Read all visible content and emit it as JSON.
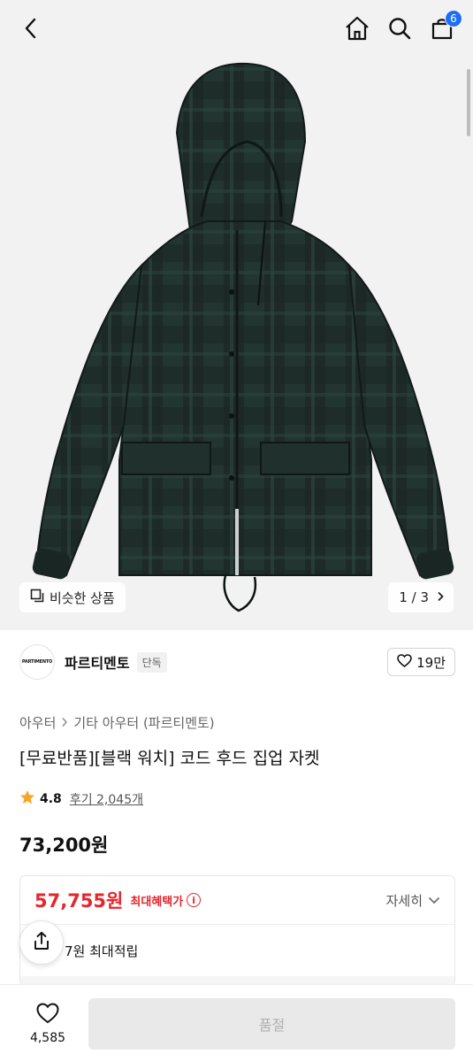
{
  "header": {
    "back_icon": "chevron-left-icon",
    "home_icon": "home-icon",
    "search_icon": "search-icon",
    "cart_icon": "shopping-bag-icon",
    "cart_count": "6"
  },
  "gallery": {
    "similar_label": "비슷한 상품",
    "pager_text": "1 / 3",
    "current_page": 1,
    "total_pages": 3
  },
  "brand": {
    "logo_text": "PARTIMENTO",
    "name": "파르티멘토",
    "tag": "단독",
    "likes": "19만"
  },
  "product": {
    "breadcrumb": [
      "아우터",
      "기타 아우터 (파르티멘토)"
    ],
    "title": "[무료반품][블랙 워치] 코드 후드 집업 자켓",
    "rating": "4.8",
    "reviews": "후기 2,045개",
    "price": "73,200원"
  },
  "benefit": {
    "max_price": "57,755원",
    "max_label": "최대혜택가",
    "detail_label": "자세히",
    "points_text": "7원 최대적립"
  },
  "bottom": {
    "wish_count": "4,585",
    "action_label": "품절"
  },
  "colors": {
    "accent_blue": "#1e6df6",
    "sale_red": "#e5262d",
    "jacket_dark": "#1b2b29",
    "jacket_green": "#2a3f3a"
  }
}
